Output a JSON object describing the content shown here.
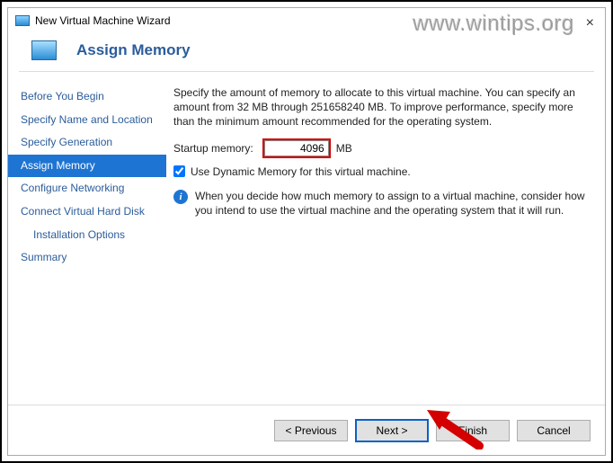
{
  "window": {
    "title": "New Virtual Machine Wizard",
    "watermark": "www.wintips.org"
  },
  "header": {
    "title": "Assign Memory"
  },
  "sidebar": {
    "items": [
      {
        "label": "Before You Begin"
      },
      {
        "label": "Specify Name and Location"
      },
      {
        "label": "Specify Generation"
      },
      {
        "label": "Assign Memory"
      },
      {
        "label": "Configure Networking"
      },
      {
        "label": "Connect Virtual Hard Disk"
      },
      {
        "label": "Installation Options"
      },
      {
        "label": "Summary"
      }
    ],
    "selected_index": 3
  },
  "content": {
    "description": "Specify the amount of memory to allocate to this virtual machine. You can specify an amount from 32 MB through 251658240 MB. To improve performance, specify more than the minimum amount recommended for the operating system.",
    "startup_label": "Startup memory:",
    "startup_value": "4096",
    "startup_unit": "MB",
    "dynamic_checkbox_label": "Use Dynamic Memory for this virtual machine.",
    "dynamic_checked": true,
    "info_text": "When you decide how much memory to assign to a virtual machine, consider how you intend to use the virtual machine and the operating system that it will run."
  },
  "footer": {
    "previous": "< Previous",
    "next": "Next >",
    "finish": "Finish",
    "cancel": "Cancel"
  }
}
